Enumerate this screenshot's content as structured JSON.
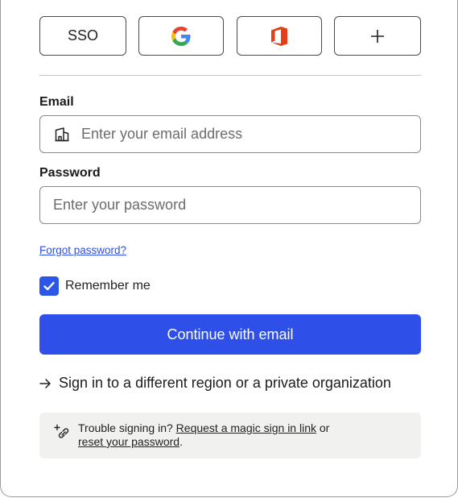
{
  "providers": {
    "sso_label": "SSO",
    "google_icon": "google-icon",
    "office_icon": "office-icon",
    "more_icon": "plus-icon"
  },
  "email": {
    "label": "Email",
    "placeholder": "Enter your email address",
    "icon": "building-icon"
  },
  "password": {
    "label": "Password",
    "placeholder": "Enter your password"
  },
  "forgot_link": "Forgot password?",
  "remember": {
    "label": "Remember me",
    "checked": true
  },
  "continue_button": "Continue with email",
  "region_link": "Sign in to a different region or a private organization",
  "help": {
    "prefix": "Trouble signing in? ",
    "magic_link": "Request a magic sign in link",
    "middle": " or",
    "reset_link": "reset your password",
    "suffix": "."
  },
  "colors": {
    "primary": "#2e4fe8",
    "link": "#2e4fe0",
    "help_bg": "#f1f1ef"
  }
}
